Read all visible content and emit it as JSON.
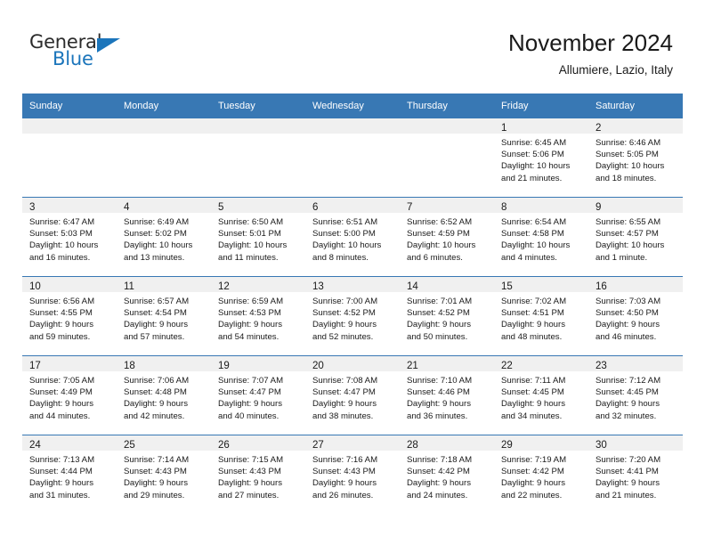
{
  "brand": {
    "name_part1": "General",
    "name_part2": "Blue"
  },
  "header": {
    "title": "November 2024",
    "subtitle": "Allumiere, Lazio, Italy"
  },
  "weekdays": [
    "Sunday",
    "Monday",
    "Tuesday",
    "Wednesday",
    "Thursday",
    "Friday",
    "Saturday"
  ],
  "colors": {
    "header_blue": "#3878b4",
    "brand_blue": "#1b75bb",
    "daynum_band": "#f0f0f0",
    "text": "#1a1a1a"
  },
  "weeks": [
    [
      {
        "day": "",
        "sunrise": "",
        "sunset": "",
        "daylight_line1": "",
        "daylight_line2": ""
      },
      {
        "day": "",
        "sunrise": "",
        "sunset": "",
        "daylight_line1": "",
        "daylight_line2": ""
      },
      {
        "day": "",
        "sunrise": "",
        "sunset": "",
        "daylight_line1": "",
        "daylight_line2": ""
      },
      {
        "day": "",
        "sunrise": "",
        "sunset": "",
        "daylight_line1": "",
        "daylight_line2": ""
      },
      {
        "day": "",
        "sunrise": "",
        "sunset": "",
        "daylight_line1": "",
        "daylight_line2": ""
      },
      {
        "day": "1",
        "sunrise": "Sunrise: 6:45 AM",
        "sunset": "Sunset: 5:06 PM",
        "daylight_line1": "Daylight: 10 hours",
        "daylight_line2": "and 21 minutes."
      },
      {
        "day": "2",
        "sunrise": "Sunrise: 6:46 AM",
        "sunset": "Sunset: 5:05 PM",
        "daylight_line1": "Daylight: 10 hours",
        "daylight_line2": "and 18 minutes."
      }
    ],
    [
      {
        "day": "3",
        "sunrise": "Sunrise: 6:47 AM",
        "sunset": "Sunset: 5:03 PM",
        "daylight_line1": "Daylight: 10 hours",
        "daylight_line2": "and 16 minutes."
      },
      {
        "day": "4",
        "sunrise": "Sunrise: 6:49 AM",
        "sunset": "Sunset: 5:02 PM",
        "daylight_line1": "Daylight: 10 hours",
        "daylight_line2": "and 13 minutes."
      },
      {
        "day": "5",
        "sunrise": "Sunrise: 6:50 AM",
        "sunset": "Sunset: 5:01 PM",
        "daylight_line1": "Daylight: 10 hours",
        "daylight_line2": "and 11 minutes."
      },
      {
        "day": "6",
        "sunrise": "Sunrise: 6:51 AM",
        "sunset": "Sunset: 5:00 PM",
        "daylight_line1": "Daylight: 10 hours",
        "daylight_line2": "and 8 minutes."
      },
      {
        "day": "7",
        "sunrise": "Sunrise: 6:52 AM",
        "sunset": "Sunset: 4:59 PM",
        "daylight_line1": "Daylight: 10 hours",
        "daylight_line2": "and 6 minutes."
      },
      {
        "day": "8",
        "sunrise": "Sunrise: 6:54 AM",
        "sunset": "Sunset: 4:58 PM",
        "daylight_line1": "Daylight: 10 hours",
        "daylight_line2": "and 4 minutes."
      },
      {
        "day": "9",
        "sunrise": "Sunrise: 6:55 AM",
        "sunset": "Sunset: 4:57 PM",
        "daylight_line1": "Daylight: 10 hours",
        "daylight_line2": "and 1 minute."
      }
    ],
    [
      {
        "day": "10",
        "sunrise": "Sunrise: 6:56 AM",
        "sunset": "Sunset: 4:55 PM",
        "daylight_line1": "Daylight: 9 hours",
        "daylight_line2": "and 59 minutes."
      },
      {
        "day": "11",
        "sunrise": "Sunrise: 6:57 AM",
        "sunset": "Sunset: 4:54 PM",
        "daylight_line1": "Daylight: 9 hours",
        "daylight_line2": "and 57 minutes."
      },
      {
        "day": "12",
        "sunrise": "Sunrise: 6:59 AM",
        "sunset": "Sunset: 4:53 PM",
        "daylight_line1": "Daylight: 9 hours",
        "daylight_line2": "and 54 minutes."
      },
      {
        "day": "13",
        "sunrise": "Sunrise: 7:00 AM",
        "sunset": "Sunset: 4:52 PM",
        "daylight_line1": "Daylight: 9 hours",
        "daylight_line2": "and 52 minutes."
      },
      {
        "day": "14",
        "sunrise": "Sunrise: 7:01 AM",
        "sunset": "Sunset: 4:52 PM",
        "daylight_line1": "Daylight: 9 hours",
        "daylight_line2": "and 50 minutes."
      },
      {
        "day": "15",
        "sunrise": "Sunrise: 7:02 AM",
        "sunset": "Sunset: 4:51 PM",
        "daylight_line1": "Daylight: 9 hours",
        "daylight_line2": "and 48 minutes."
      },
      {
        "day": "16",
        "sunrise": "Sunrise: 7:03 AM",
        "sunset": "Sunset: 4:50 PM",
        "daylight_line1": "Daylight: 9 hours",
        "daylight_line2": "and 46 minutes."
      }
    ],
    [
      {
        "day": "17",
        "sunrise": "Sunrise: 7:05 AM",
        "sunset": "Sunset: 4:49 PM",
        "daylight_line1": "Daylight: 9 hours",
        "daylight_line2": "and 44 minutes."
      },
      {
        "day": "18",
        "sunrise": "Sunrise: 7:06 AM",
        "sunset": "Sunset: 4:48 PM",
        "daylight_line1": "Daylight: 9 hours",
        "daylight_line2": "and 42 minutes."
      },
      {
        "day": "19",
        "sunrise": "Sunrise: 7:07 AM",
        "sunset": "Sunset: 4:47 PM",
        "daylight_line1": "Daylight: 9 hours",
        "daylight_line2": "and 40 minutes."
      },
      {
        "day": "20",
        "sunrise": "Sunrise: 7:08 AM",
        "sunset": "Sunset: 4:47 PM",
        "daylight_line1": "Daylight: 9 hours",
        "daylight_line2": "and 38 minutes."
      },
      {
        "day": "21",
        "sunrise": "Sunrise: 7:10 AM",
        "sunset": "Sunset: 4:46 PM",
        "daylight_line1": "Daylight: 9 hours",
        "daylight_line2": "and 36 minutes."
      },
      {
        "day": "22",
        "sunrise": "Sunrise: 7:11 AM",
        "sunset": "Sunset: 4:45 PM",
        "daylight_line1": "Daylight: 9 hours",
        "daylight_line2": "and 34 minutes."
      },
      {
        "day": "23",
        "sunrise": "Sunrise: 7:12 AM",
        "sunset": "Sunset: 4:45 PM",
        "daylight_line1": "Daylight: 9 hours",
        "daylight_line2": "and 32 minutes."
      }
    ],
    [
      {
        "day": "24",
        "sunrise": "Sunrise: 7:13 AM",
        "sunset": "Sunset: 4:44 PM",
        "daylight_line1": "Daylight: 9 hours",
        "daylight_line2": "and 31 minutes."
      },
      {
        "day": "25",
        "sunrise": "Sunrise: 7:14 AM",
        "sunset": "Sunset: 4:43 PM",
        "daylight_line1": "Daylight: 9 hours",
        "daylight_line2": "and 29 minutes."
      },
      {
        "day": "26",
        "sunrise": "Sunrise: 7:15 AM",
        "sunset": "Sunset: 4:43 PM",
        "daylight_line1": "Daylight: 9 hours",
        "daylight_line2": "and 27 minutes."
      },
      {
        "day": "27",
        "sunrise": "Sunrise: 7:16 AM",
        "sunset": "Sunset: 4:43 PM",
        "daylight_line1": "Daylight: 9 hours",
        "daylight_line2": "and 26 minutes."
      },
      {
        "day": "28",
        "sunrise": "Sunrise: 7:18 AM",
        "sunset": "Sunset: 4:42 PM",
        "daylight_line1": "Daylight: 9 hours",
        "daylight_line2": "and 24 minutes."
      },
      {
        "day": "29",
        "sunrise": "Sunrise: 7:19 AM",
        "sunset": "Sunset: 4:42 PM",
        "daylight_line1": "Daylight: 9 hours",
        "daylight_line2": "and 22 minutes."
      },
      {
        "day": "30",
        "sunrise": "Sunrise: 7:20 AM",
        "sunset": "Sunset: 4:41 PM",
        "daylight_line1": "Daylight: 9 hours",
        "daylight_line2": "and 21 minutes."
      }
    ]
  ]
}
